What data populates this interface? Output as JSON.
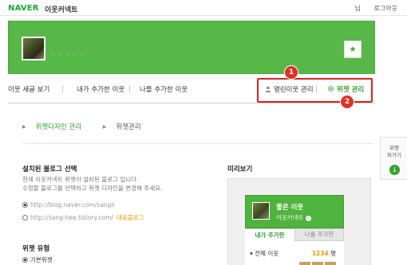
{
  "topbar": {
    "brand": "NAVER",
    "service": "이웃커넥트",
    "user_suffix": "님",
    "logout": "로그아웃"
  },
  "header": {
    "profile_name": "· · · · ·",
    "star_label": "★"
  },
  "nav": {
    "items": [
      {
        "label": "이웃 새글 보기"
      },
      {
        "label": "내가 추가한 이웃"
      },
      {
        "label": "나를 추가한 이웃"
      }
    ],
    "open_neighbor": "열린이웃 관리",
    "widget_manage": "위젯 관리"
  },
  "badges": {
    "one": "1",
    "two": "2"
  },
  "subtabs": {
    "design": "위젯디자인 관리",
    "manage": "위젯관리"
  },
  "install": {
    "title": "설치된 블로그 선택",
    "desc_line1": "현재 이웃커넥트 위젯이 설치된 블로그 입니다.",
    "desc_line2": "수정할 블로그를 선택하고 위젯 디자인을 변경해 주세요.",
    "blog1": "http://blog.naver.com/sangii",
    "blog2": "http://sang-hee.tistory.com/",
    "rep_label": "대표블로그"
  },
  "widget_type": {
    "title": "위젯 유형",
    "option1": "기본위젯"
  },
  "preview": {
    "title": "미리보기",
    "widget_title": "좋은 이웃",
    "widget_sub": "이웃커넥트",
    "tab1": "내가 추가한",
    "tab2": "나를 추가한",
    "row_label": "전체 이웃",
    "count": "1234",
    "count_unit": "명"
  },
  "side_widget": {
    "line1": "위젯",
    "line2": "퍼가기"
  },
  "colors": {
    "naver_green": "#1aa83c",
    "header_green": "#57b847",
    "highlight_red": "#d9241c",
    "accent_orange": "#f39800"
  }
}
